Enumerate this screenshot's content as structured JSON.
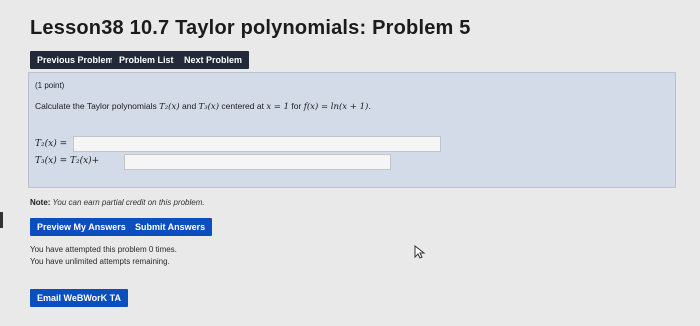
{
  "page": {
    "title": "Lesson38 10.7 Taylor polynomials: Problem 5"
  },
  "nav": {
    "previous": "Previous Problem",
    "list": "Problem List",
    "next": "Next Problem"
  },
  "problem": {
    "points": "(1 point)",
    "question_prefix": "Calculate the Taylor polynomials ",
    "t2": "T₂(x)",
    "and": " and ",
    "t3": "T₃(x)",
    "centered": " centered at ",
    "center_expr": "x = 1",
    "for": " for ",
    "func_expr": "f(x) = ln(x + 1).",
    "answer1_label": "T₂(x) =",
    "answer2_label": "T₃(x) = T₂(x)+",
    "answer1_value": "",
    "answer2_value": ""
  },
  "note": {
    "label": "Note:",
    "text": " You can earn partial credit on this problem."
  },
  "actions": {
    "preview": "Preview My Answers",
    "submit": "Submit Answers"
  },
  "status": {
    "attempted": "You have attempted this problem 0 times.",
    "remaining": "You have unlimited attempts remaining."
  },
  "email": {
    "label": "Email WeBWorK TA"
  },
  "colors": {
    "dark_button": "#222a3a",
    "blue_button": "#0c4dbf",
    "problem_bg": "#d3dbe8"
  }
}
